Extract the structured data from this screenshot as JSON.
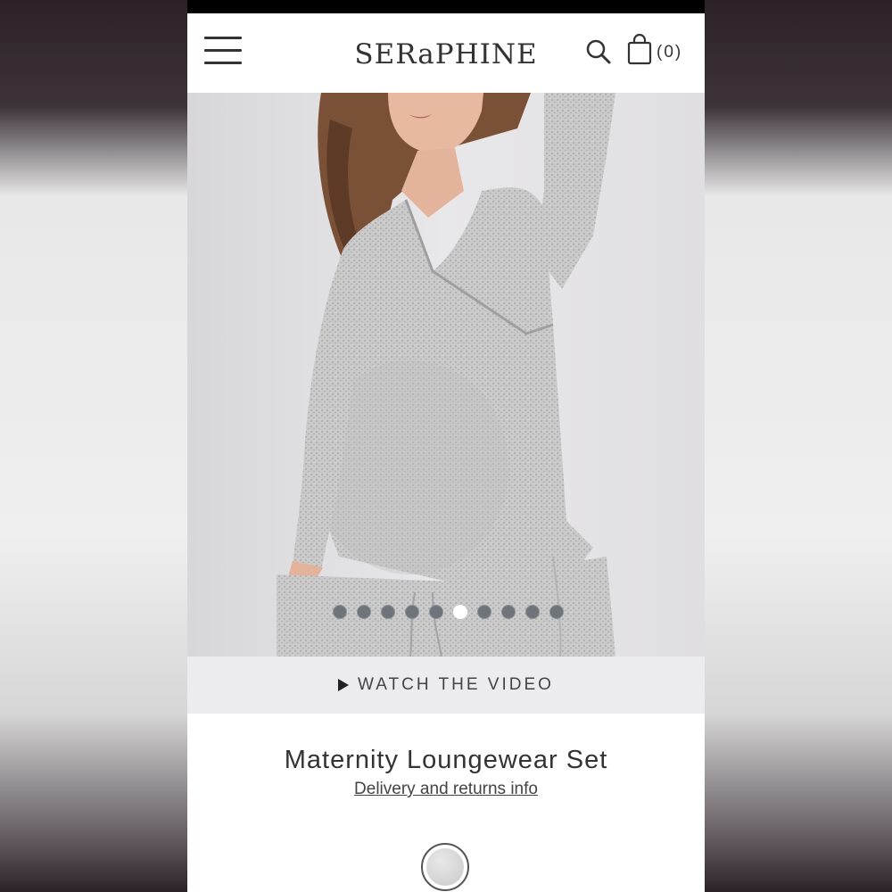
{
  "header": {
    "brand": "SERaPHINE",
    "bag_count": "(0)"
  },
  "hero": {
    "image_alt": "model wearing grey marl wrap top and joggers",
    "carousel": {
      "total": 10,
      "active_index": 5
    }
  },
  "video": {
    "label": "WATCH THE VIDEO"
  },
  "product": {
    "title": "Maternity Loungewear Set",
    "delivery_link": "Delivery and returns info"
  },
  "colors": {
    "fabric": "#c8c8c8",
    "text": "#333333",
    "video_bar": "#ececee",
    "dot_inactive": "#6e7479",
    "dot_active": "#ffffff"
  },
  "icons": [
    "hamburger-menu-icon",
    "search-icon",
    "shopping-bag-icon",
    "play-icon"
  ]
}
